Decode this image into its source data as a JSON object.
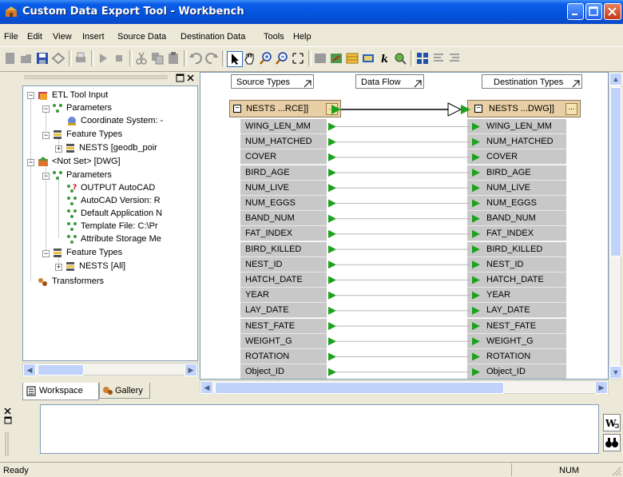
{
  "window": {
    "title": "Custom Data Export Tool - Workbench"
  },
  "menu": [
    "File",
    "Edit",
    "View",
    "Insert",
    "Source Data",
    "Destination Data",
    "Tools",
    "Help"
  ],
  "tree": {
    "nodes": [
      {
        "label": "ETL Tool Input",
        "icon": "etl-input-icon"
      },
      {
        "label": "Parameters",
        "icon": "parameters-icon"
      },
      {
        "label": "Coordinate System: -",
        "icon": "coordinate-system-icon"
      },
      {
        "label": "Feature Types",
        "icon": "feature-types-icon"
      },
      {
        "label": "NESTS [geodb_poir",
        "icon": "feature-type-icon"
      },
      {
        "label": "<Not Set> [DWG]",
        "icon": "dwg-output-icon"
      },
      {
        "label": "Parameters",
        "icon": "parameters-icon"
      },
      {
        "label": "OUTPUT AutoCAD",
        "icon": "parameter-unset-icon"
      },
      {
        "label": "AutoCAD Version: R",
        "icon": "parameter-icon"
      },
      {
        "label": "Default Application N",
        "icon": "parameter-icon"
      },
      {
        "label": "Template File: C:\\Pr",
        "icon": "parameter-icon"
      },
      {
        "label": "Attribute Storage Me",
        "icon": "parameter-icon"
      },
      {
        "label": "Feature Types",
        "icon": "feature-types-icon"
      },
      {
        "label": "NESTS [All]",
        "icon": "feature-type-icon"
      },
      {
        "label": "Transformers",
        "icon": "transformers-icon"
      }
    ]
  },
  "left_tabs": {
    "workspace": "Workspace",
    "gallery": "Gallery"
  },
  "canvas": {
    "source_header": "Source Types",
    "flow_header": "Data Flow",
    "dest_header": "Destination Types",
    "source_feature": "NESTS ...RCE]]",
    "dest_feature": "NESTS ...DWG]]",
    "dots": "...",
    "attributes": [
      "WING_LEN_MM",
      "NUM_HATCHED",
      "COVER",
      "BIRD_AGE",
      "NUM_LIVE",
      "NUM_EGGS",
      "BAND_NUM",
      "FAT_INDEX",
      "BIRD_KILLED",
      "NEST_ID",
      "HATCH_DATE",
      "YEAR",
      "LAY_DATE",
      "NEST_FATE",
      "WEIGHT_G",
      "ROTATION",
      "Object_ID"
    ]
  },
  "status": {
    "text": "Ready",
    "num": "NUM"
  },
  "colors": {
    "title_bar": "#0a5ce8",
    "feature_header": "#e8cfa5",
    "attribute_bg": "#c8c8c8",
    "port_green": "#1ca21c"
  }
}
